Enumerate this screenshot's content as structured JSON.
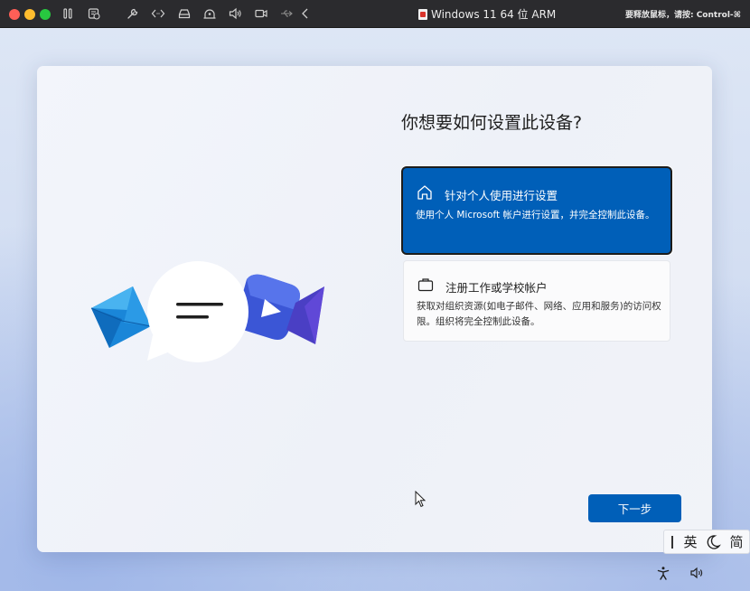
{
  "vm_window": {
    "title": "Windows 11 64 位 ARM",
    "release_hint": "要释放鼠标，请按: Control-⌘",
    "toolbar_icons": [
      "pause-icon",
      "snapshot-icon",
      "settings-wrench-icon",
      "code-brackets-icon",
      "drive-icon",
      "network-icon",
      "sound-icon",
      "camera-icon",
      "usb-icon",
      "back-chevron-icon"
    ]
  },
  "setup": {
    "heading": "你想要如何设置此设备?",
    "options": [
      {
        "icon": "home-icon",
        "title": "针对个人使用进行设置",
        "description": "使用个人 Microsoft 帐户进行设置，并完全控制此设备。",
        "selected": true
      },
      {
        "icon": "briefcase-icon",
        "title": "注册工作或学校帐户",
        "description": "获取对组织资源(如电子邮件、网络、应用和服务)的访问权限。组织将完全控制此设备。",
        "selected": false
      }
    ],
    "next_button": "下一步"
  },
  "ime": {
    "language": "英",
    "mode": "简"
  },
  "colors": {
    "accent": "#005fb8",
    "titlebar": "#2b2b2e"
  }
}
